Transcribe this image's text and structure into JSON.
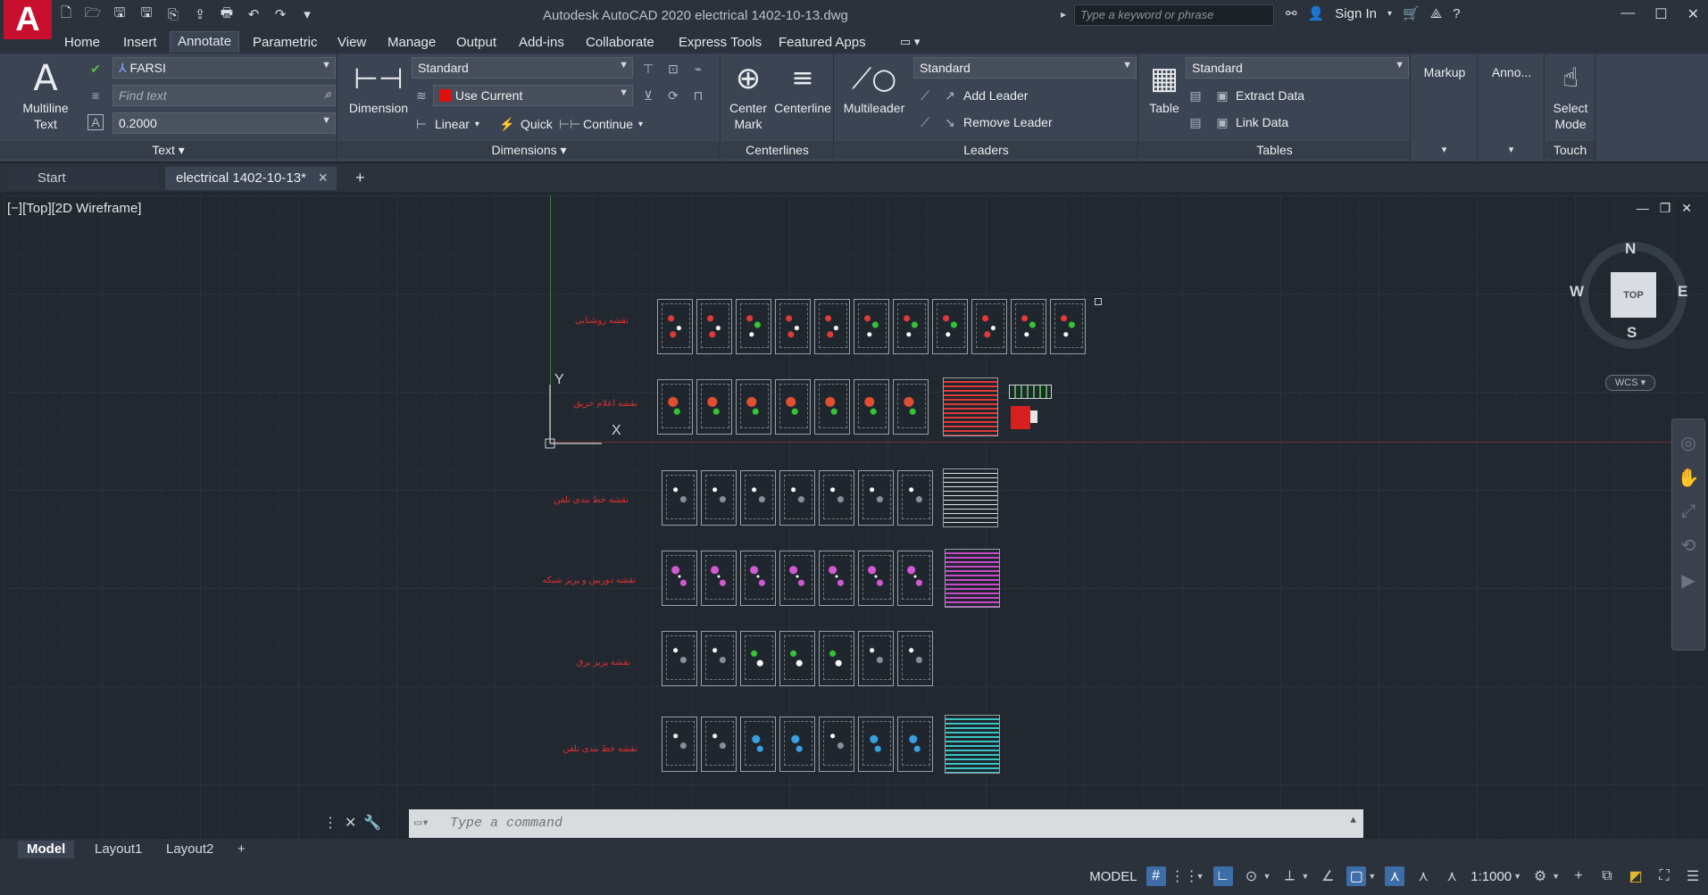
{
  "app": {
    "title": "Autodesk AutoCAD 2020    electrical 1402-10-13.dwg",
    "logo_letter": "A",
    "search_placeholder": "Type a keyword or phrase",
    "sign_in": "Sign In"
  },
  "menu_tabs": [
    "Home",
    "Insert",
    "Annotate",
    "Parametric",
    "View",
    "Manage",
    "Output",
    "Add-ins",
    "Collaborate",
    "Express Tools",
    "Featured Apps"
  ],
  "active_menu_tab": "Annotate",
  "ribbon": {
    "text": {
      "multiline_text_line1": "Multiline",
      "multiline_text_line2": "Text",
      "text_style": "FARSI",
      "find_text_placeholder": "Find text",
      "text_height": "0.2000",
      "panel_label": "Text"
    },
    "dimensions": {
      "dimension_label": "Dimension",
      "dim_style": "Standard",
      "layer": "Use Current",
      "linear": "Linear",
      "quick": "Quick",
      "continue": "Continue",
      "panel_label": "Dimensions"
    },
    "centerlines": {
      "center_mark_line1": "Center",
      "center_mark_line2": "Mark",
      "centerline": "Centerline",
      "panel_label": "Centerlines"
    },
    "leaders": {
      "multileader": "Multileader",
      "style": "Standard",
      "add_leader": "Add Leader",
      "remove_leader": "Remove Leader",
      "panel_label": "Leaders"
    },
    "tables": {
      "table": "Table",
      "style": "Standard",
      "extract_data": "Extract Data",
      "link_data": "Link Data",
      "panel_label": "Tables"
    },
    "markup": {
      "label": "Markup"
    },
    "anno": {
      "label": "Anno..."
    },
    "touch": {
      "select_mode_line1": "Select",
      "select_mode_line2": "Mode",
      "panel_label": "Touch"
    }
  },
  "doc_tabs": {
    "start": "Start",
    "active": "electrical 1402-10-13*"
  },
  "viewport": {
    "label": "[−][Top][2D Wireframe]",
    "ucs_x": "X",
    "ucs_y": "Y"
  },
  "viewcube": {
    "face": "TOP",
    "north": "N",
    "south": "S",
    "east": "E",
    "west": "W",
    "wcs": "WCS"
  },
  "command_line": {
    "placeholder": "Type a command"
  },
  "layout_tabs": [
    "Model",
    "Layout1",
    "Layout2"
  ],
  "status_bar": {
    "model": "MODEL",
    "scale": "1:1000"
  }
}
